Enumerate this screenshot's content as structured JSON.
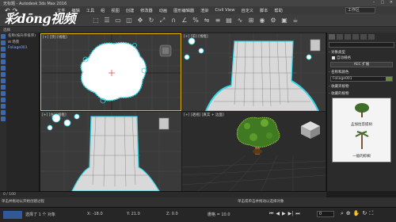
{
  "window": {
    "title": "无标题 - Autodesk 3ds Max 2016",
    "watermark": "彩dōng视频"
  },
  "menubar": {
    "items": [
      "文件",
      "编辑",
      "工具",
      "组",
      "视图",
      "创建",
      "修改器",
      "动画",
      "图形编辑器",
      "渲染",
      "Civil View",
      "自定义",
      "脚本",
      "帮助"
    ],
    "workspace": "工作区"
  },
  "subbar": {
    "label": "选择"
  },
  "scene_panel": {
    "rows": [
      "名称(按升序排序)",
      "⊟ 场景",
      "  Foliage001",
      "",
      ""
    ]
  },
  "viewports": {
    "top_left": "[+] [顶] [线框]",
    "top_right": "[+] [前] [线框]",
    "bottom_left": "[+] [左] [线框]",
    "bottom_right": "[+] [透视] [真实 + 边面]"
  },
  "right_panel": {
    "dropdown": "",
    "object_type_section": "对象类型",
    "auto_grid": "自动栅格",
    "autogrid_button": "AEC 扩展",
    "name_color_section": "名称和颜色",
    "object_name": "Foliage001",
    "favorite_section": "收藏夹植物",
    "plant_list_section": "收藏的植物",
    "plants": [
      {
        "name": "孟加拉菩提树"
      },
      {
        "name": "一般的棕榈"
      }
    ]
  },
  "timeline": {
    "text": "0 / 100"
  },
  "status": {
    "left": "单击并拖动以开始创建过程",
    "mid": "",
    "right": "单击或单击并拖动以选择对象"
  },
  "bottombar": {
    "selected": "选择了 1 个 对象",
    "x": "X: -18.0",
    "y": "Y: 21.0",
    "z": "Z: 0.0",
    "grid": "栅格 = 10.0",
    "frame": "0",
    "add_time_tag": "添加时间标记"
  }
}
